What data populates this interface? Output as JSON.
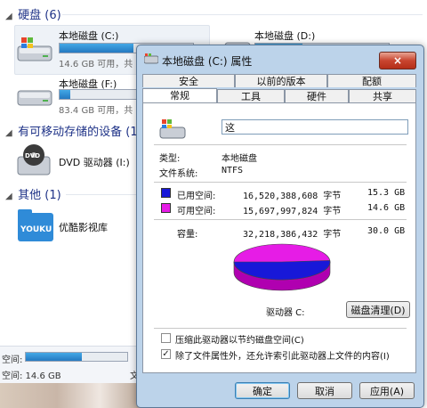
{
  "explorer": {
    "sections": {
      "hard_disks": "硬盘 (6)",
      "removable": "有可移动存储的设备 (1",
      "other": "其他 (1)"
    },
    "drives": [
      {
        "label": "本地磁盘 (C:)",
        "info": "14.6 GB 可用，共",
        "fill": 0.55
      },
      {
        "label": "本地磁盘 (D:)",
        "info": "",
        "fill": 0.35
      },
      {
        "label": "本地磁盘 (F:)",
        "info": "83.4 GB 可用，共",
        "fill": 0.08
      }
    ],
    "dvd": {
      "label": "DVD 驱动器 (I:)"
    },
    "youku": {
      "label": "优酷影视库",
      "logo": "YOUKU"
    },
    "status": {
      "line1": "空间:",
      "line2": "空间: 14.6 GB",
      "side": "文",
      "fill": 0.55
    }
  },
  "dialog": {
    "title": "本地磁盘 (C:) 属性",
    "close_label": "×",
    "tabs_back": [
      "安全",
      "以前的版本",
      "配额"
    ],
    "tabs_front": [
      "常规",
      "工具",
      "硬件",
      "共享"
    ],
    "name_value": "这",
    "type_label": "类型:",
    "type_value": "本地磁盘",
    "fs_label": "文件系统:",
    "fs_value": "NTFS",
    "used_label": "已用空间:",
    "used_bytes": "16,520,388,608 字节",
    "used_gb": "15.3 GB",
    "free_label": "可用空间:",
    "free_bytes": "15,697,997,824 字节",
    "free_gb": "14.6 GB",
    "capacity_label": "容量:",
    "capacity_bytes": "32,218,386,432 字节",
    "capacity_gb": "30.0 GB",
    "drive_caption": "驱动器 C:",
    "cleanup_button": "磁盘清理(D)",
    "compress_label": "压缩此驱动器以节约磁盘空间(C)",
    "index_label": "除了文件属性外，还允许索引此驱动器上文件的内容(I)",
    "ok": "确定",
    "cancel": "取消",
    "apply": "应用(A)",
    "colors": {
      "used": "#1818d8",
      "free": "#e61ce6"
    }
  }
}
